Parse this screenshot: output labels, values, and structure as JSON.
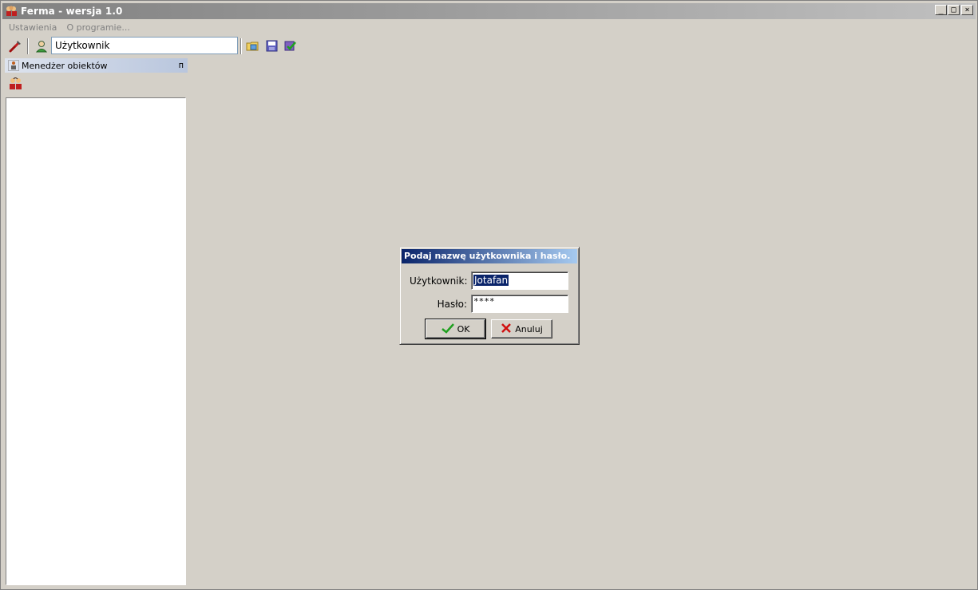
{
  "window": {
    "title": "Ferma - wersja 1.0",
    "buttons": {
      "minimize": "_",
      "maximize": "□",
      "close": "×"
    }
  },
  "menu": {
    "items": [
      {
        "label": "Ustawienia"
      },
      {
        "label": "O programie..."
      }
    ]
  },
  "toolbar": {
    "user_field_value": "Użytkownik",
    "icons": [
      "wrench-icon",
      "user-icon",
      "open-folder-icon",
      "save-icon",
      "save-check-icon"
    ]
  },
  "panel": {
    "title": "Menedżer obiektów",
    "pin_glyph": "ᴨ"
  },
  "dialog": {
    "title": "Podaj nazwę użytkownika i hasło.",
    "user_label": "Użytkownik:",
    "user_value": "Jotafan",
    "password_label": "Hasło:",
    "password_value": "****",
    "ok_label": "OK",
    "cancel_label": "Anuluj"
  },
  "colors": {
    "background": "#d4d0c8",
    "dialog_title": "#0a246a",
    "selection": "#0a246a"
  }
}
